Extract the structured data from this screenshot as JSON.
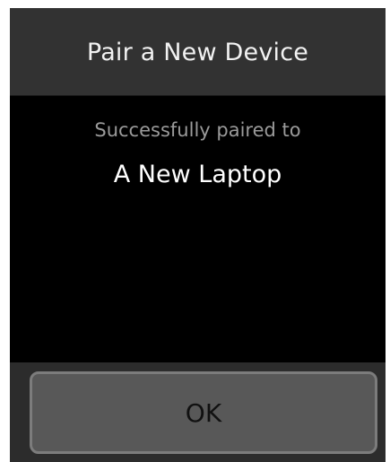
{
  "dialog": {
    "title": "Pair a New Device",
    "subtitle": "Successfully paired to",
    "device_name": "A New Laptop",
    "ok_label": "OK"
  },
  "colors": {
    "header_bg": "#323232",
    "body_bg": "#000000",
    "button_bg": "#585858",
    "button_border": "#7c7c7c",
    "title_text": "#f2f2f2",
    "subtitle_text": "#9a9a9a"
  }
}
